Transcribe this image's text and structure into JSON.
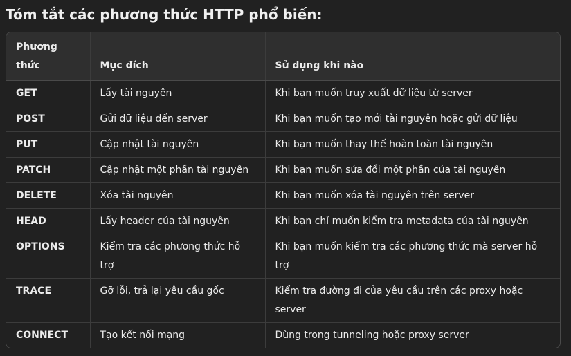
{
  "heading": "Tóm tắt các phương thức HTTP phổ biến:",
  "table": {
    "headers": [
      "Phương thức",
      "Mục đích",
      "Sử dụng khi nào"
    ],
    "rows": [
      [
        "GET",
        "Lấy tài nguyên",
        "Khi bạn muốn truy xuất dữ liệu từ server"
      ],
      [
        "POST",
        "Gửi dữ liệu đến server",
        "Khi bạn muốn tạo mới tài nguyên hoặc gửi dữ liệu"
      ],
      [
        "PUT",
        "Cập nhật tài nguyên",
        "Khi bạn muốn thay thế hoàn toàn tài nguyên"
      ],
      [
        "PATCH",
        "Cập nhật một phần tài nguyên",
        "Khi bạn muốn sửa đổi một phần của tài nguyên"
      ],
      [
        "DELETE",
        "Xóa tài nguyên",
        "Khi bạn muốn xóa tài nguyên trên server"
      ],
      [
        "HEAD",
        "Lấy header của tài nguyên",
        "Khi bạn chỉ muốn kiểm tra metadata của tài nguyên"
      ],
      [
        "OPTIONS",
        "Kiểm tra các phương thức hỗ trợ",
        "Khi bạn muốn kiểm tra các phương thức mà server hỗ trợ"
      ],
      [
        "TRACE",
        "Gỡ lỗi, trả lại yêu cầu gốc",
        "Kiểm tra đường đi của yêu cầu trên các proxy hoặc server"
      ],
      [
        "CONNECT",
        "Tạo kết nối mạng",
        "Dùng trong tunneling hoặc proxy server"
      ]
    ]
  }
}
